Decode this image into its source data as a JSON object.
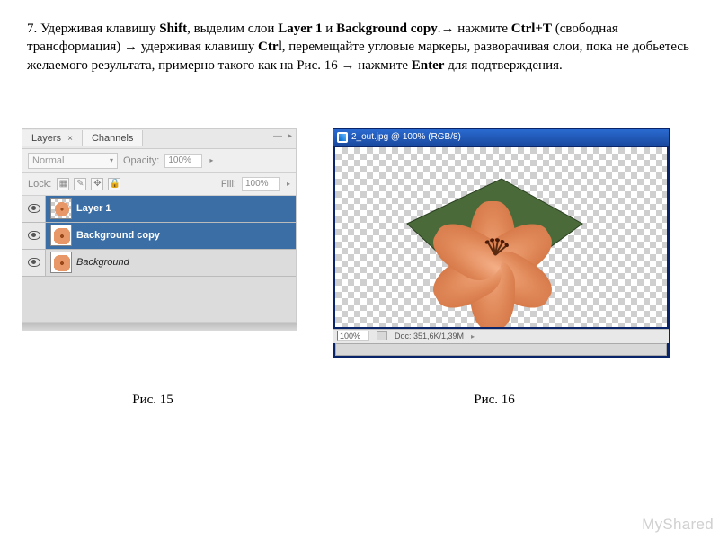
{
  "instruction": {
    "num": "7.",
    "t1": " Удерживая клавишу ",
    "k1": "Shift",
    "t2": ", выделим слои ",
    "k2": "Layer 1",
    "t3": " и ",
    "k3": "Background copy",
    "t4": ".→ нажмите  ",
    "k4": "Ctrl+T",
    "t5": " (свободная трансформация) → удерживая клавишу ",
    "k5": "Ctrl",
    "t6": ", перемещайте угловые маркеры, разворачивая слои, пока не добьетесь желаемого результата, примерно такого как на Рис. 16 → нажмите ",
    "k6": "Enter",
    "t7": " для подтверждения."
  },
  "layers_panel": {
    "tab_layers": "Layers",
    "tab_channels": "Channels",
    "blend_mode": "Normal",
    "opacity_label": "Opacity:",
    "opacity_value": "100%",
    "lock_label": "Lock:",
    "fill_label": "Fill:",
    "fill_value": "100%",
    "layers": [
      {
        "name": "Layer 1",
        "selected": true
      },
      {
        "name": "Background copy",
        "selected": true
      },
      {
        "name": "Background",
        "selected": false
      }
    ]
  },
  "image_window": {
    "title": "2_out.jpg @ 100% (RGB/8)",
    "zoom": "100%",
    "doc_info": "Doc: 351,6K/1,39M"
  },
  "captions": {
    "fig15": "Рис. 15",
    "fig16": "Рис. 16"
  },
  "watermark": "MyShared"
}
